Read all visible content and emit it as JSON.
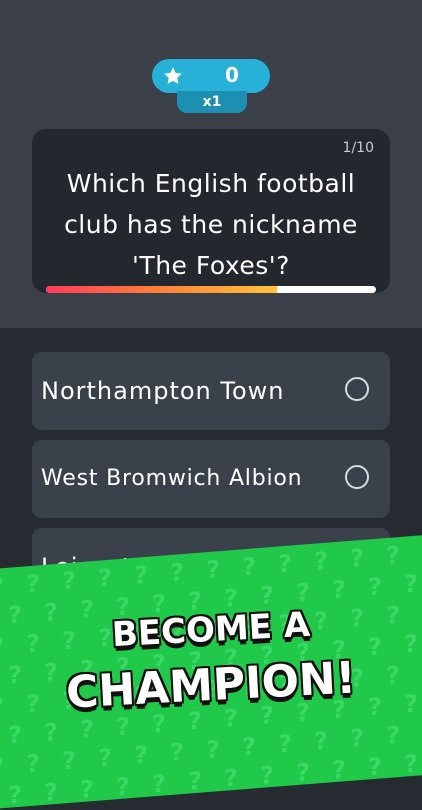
{
  "header": {
    "score": "0",
    "multiplier": "x1",
    "score_icon": "star-icon"
  },
  "question": {
    "counter": "1/10",
    "line1": "Which English football",
    "line2": "club has the nickname",
    "line3": "'The Foxes'?",
    "time_remaining_fraction": 0.7
  },
  "answers": [
    {
      "label": "Northampton Town"
    },
    {
      "label": "West Bromwich Albion"
    },
    {
      "label": "Leicester City"
    }
  ],
  "promo": {
    "line1": "BECOME A",
    "line2": "CHAMPION!"
  },
  "colors": {
    "accent": "#28b1d8",
    "banner": "#20c94a",
    "timer_start": "#ff3b5c",
    "timer_end": "#ffc43a"
  }
}
